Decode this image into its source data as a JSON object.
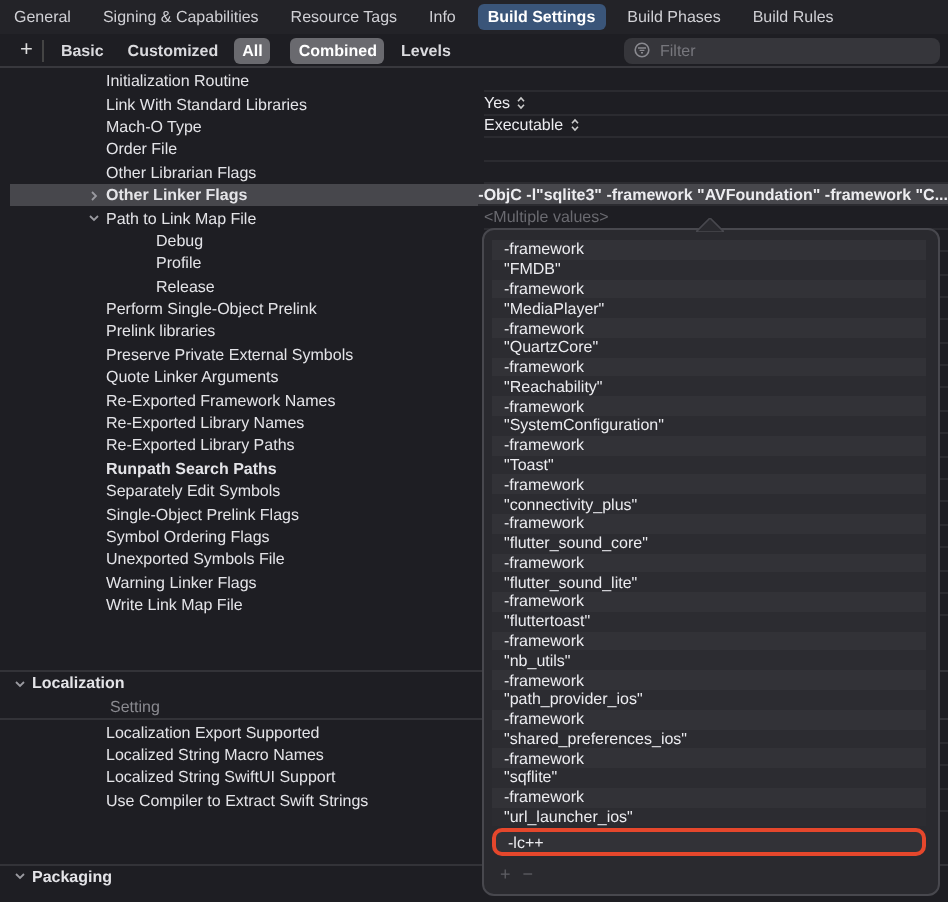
{
  "tabs": [
    {
      "label": "General",
      "selected": false
    },
    {
      "label": "Signing & Capabilities",
      "selected": false
    },
    {
      "label": "Resource Tags",
      "selected": false
    },
    {
      "label": "Info",
      "selected": false
    },
    {
      "label": "Build Settings",
      "selected": true
    },
    {
      "label": "Build Phases",
      "selected": false
    },
    {
      "label": "Build Rules",
      "selected": false
    }
  ],
  "toolbar": {
    "add": "+",
    "filters": [
      {
        "label": "Basic",
        "selected": false
      },
      {
        "label": "Customized",
        "selected": false
      },
      {
        "label": "All",
        "selected": true
      }
    ],
    "views": [
      {
        "label": "Combined",
        "selected": true
      },
      {
        "label": "Levels",
        "selected": false
      }
    ],
    "search": {
      "placeholder": "Filter"
    }
  },
  "sections": [
    {
      "rows": [
        {
          "name": "Initialization Routine",
          "customized": false,
          "selected": false
        },
        {
          "name": "Link With Standard Libraries",
          "value": "Yes",
          "customized": false,
          "selected": false
        },
        {
          "name": "Mach-O Type",
          "value": "Executable",
          "customized": false,
          "selected": false
        },
        {
          "name": "Order File",
          "customized": false,
          "selected": false
        },
        {
          "name": "Other Librarian Flags",
          "customized": false,
          "selected": false
        },
        {
          "name": "Other Linker Flags",
          "value": "-ObjC -l\"sqlite3\" -framework \"AVFoundation\" -framework \"C...",
          "customized": true,
          "selected": true,
          "expanded": false
        },
        {
          "name": "Path to Link Map File",
          "placeholder": "<Multiple values>",
          "customized": false,
          "selected": false,
          "expanded": true,
          "children": [
            {
              "name": "Debug",
              "customized": false,
              "selected": false
            },
            {
              "name": "Profile",
              "customized": false,
              "selected": false
            },
            {
              "name": "Release",
              "customized": false,
              "selected": false
            }
          ]
        },
        {
          "name": "Perform Single-Object Prelink",
          "customized": false,
          "selected": false
        },
        {
          "name": "Prelink libraries",
          "customized": false,
          "selected": false
        },
        {
          "name": "Preserve Private External Symbols",
          "customized": false,
          "selected": false
        },
        {
          "name": "Quote Linker Arguments",
          "customized": false,
          "selected": false
        },
        {
          "name": "Re-Exported Framework Names",
          "customized": false,
          "selected": false
        },
        {
          "name": "Re-Exported Library Names",
          "customized": false,
          "selected": false
        },
        {
          "name": "Re-Exported Library Paths",
          "customized": false,
          "selected": false
        },
        {
          "name": "Runpath Search Paths",
          "customized": true,
          "selected": false
        },
        {
          "name": "Separately Edit Symbols",
          "customized": false,
          "selected": false
        },
        {
          "name": "Single-Object Prelink Flags",
          "customized": false,
          "selected": false
        },
        {
          "name": "Symbol Ordering Flags",
          "customized": false,
          "selected": false
        },
        {
          "name": "Unexported Symbols File",
          "customized": false,
          "selected": false
        },
        {
          "name": "Warning Linker Flags",
          "customized": false,
          "selected": false
        },
        {
          "name": "Write Link Map File",
          "customized": false,
          "selected": false
        }
      ]
    },
    {
      "title": "Localization",
      "expanded": true,
      "column_header": "Setting",
      "rows": [
        {
          "name": "Localization Export Supported",
          "customized": false,
          "selected": false
        },
        {
          "name": "Localized String Macro Names",
          "customized": false,
          "selected": false
        },
        {
          "name": "Localized String SwiftUI Support",
          "customized": false,
          "selected": false
        },
        {
          "name": "Use Compiler to Extract Swift Strings",
          "customized": false,
          "selected": false
        }
      ]
    },
    {
      "title": "Packaging",
      "expanded": true
    }
  ],
  "popover": {
    "items": [
      {
        "text": "-framework",
        "highlighted": false
      },
      {
        "text": "\"FMDB\"",
        "highlighted": false
      },
      {
        "text": "-framework",
        "highlighted": false
      },
      {
        "text": "\"MediaPlayer\"",
        "highlighted": false
      },
      {
        "text": "-framework",
        "highlighted": false
      },
      {
        "text": "\"QuartzCore\"",
        "highlighted": false
      },
      {
        "text": "-framework",
        "highlighted": false
      },
      {
        "text": "\"Reachability\"",
        "highlighted": false
      },
      {
        "text": "-framework",
        "highlighted": false
      },
      {
        "text": "\"SystemConfiguration\"",
        "highlighted": false
      },
      {
        "text": "-framework",
        "highlighted": false
      },
      {
        "text": "\"Toast\"",
        "highlighted": false
      },
      {
        "text": "-framework",
        "highlighted": false
      },
      {
        "text": "\"connectivity_plus\"",
        "highlighted": false
      },
      {
        "text": "-framework",
        "highlighted": false
      },
      {
        "text": "\"flutter_sound_core\"",
        "highlighted": false
      },
      {
        "text": "-framework",
        "highlighted": false
      },
      {
        "text": "\"flutter_sound_lite\"",
        "highlighted": false
      },
      {
        "text": "-framework",
        "highlighted": false
      },
      {
        "text": "\"fluttertoast\"",
        "highlighted": false
      },
      {
        "text": "-framework",
        "highlighted": false
      },
      {
        "text": "\"nb_utils\"",
        "highlighted": false
      },
      {
        "text": "-framework",
        "highlighted": false
      },
      {
        "text": "\"path_provider_ios\"",
        "highlighted": false
      },
      {
        "text": "-framework",
        "highlighted": false
      },
      {
        "text": "\"shared_preferences_ios\"",
        "highlighted": false
      },
      {
        "text": "-framework",
        "highlighted": false
      },
      {
        "text": "\"sqflite\"",
        "highlighted": false
      },
      {
        "text": "-framework",
        "highlighted": false
      },
      {
        "text": "\"url_launcher_ios\"",
        "highlighted": false
      },
      {
        "text": "-lc++",
        "highlighted": true
      }
    ],
    "buttons": [
      "+",
      "−"
    ]
  }
}
